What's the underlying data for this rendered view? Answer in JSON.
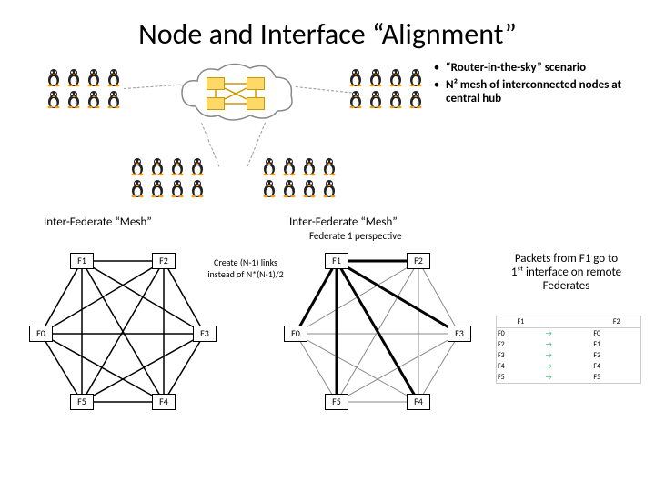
{
  "title": "Node and Interface “Alignment”",
  "bullets": [
    "“Router-in-the-sky” scenario",
    "N² mesh of interconnected nodes at central hub"
  ],
  "mesh_left_title": "Inter-Federate “Mesh”",
  "mesh_right_title": "Inter-Federate “Mesh”",
  "mesh_right_sub": "Federate 1 perspective",
  "create_note_l1": "Create (N-1) links",
  "create_note_l2": "instead of N*(N-1)/2",
  "right_note_l1": "Packets from F1 go to",
  "right_note_l2": "1ˢᵗ interface on remote",
  "right_note_l3": "Federates",
  "nodes": [
    "F0",
    "F1",
    "F2",
    "F3",
    "F4",
    "F5"
  ],
  "table": {
    "headers": [
      "F1",
      "F2"
    ],
    "rows": [
      [
        "F0",
        "→",
        "F0"
      ],
      [
        "F2",
        "→",
        "F1"
      ],
      [
        "F3",
        "→",
        "F3"
      ],
      [
        "F4",
        "→",
        "F4"
      ],
      [
        "F5",
        "→",
        "F5"
      ]
    ]
  }
}
